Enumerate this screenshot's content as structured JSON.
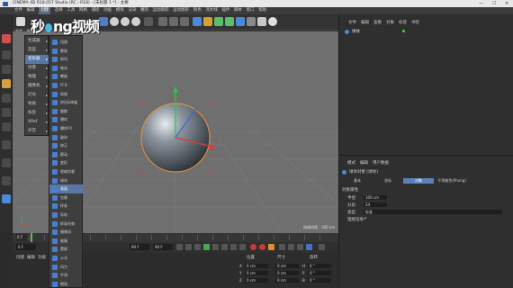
{
  "window": {
    "title": "CINEMA 4D R18.057 Studio (RC - R18) - [未标题 1 *] - 主要",
    "controls": [
      "—",
      "☐",
      "✕"
    ]
  },
  "watermark": {
    "text_before": "秒",
    "text_after": "ng视频",
    "mascot_letter": "o"
  },
  "menubar": {
    "items": [
      "文件",
      "编辑",
      "创建",
      "选择",
      "工具",
      "网格",
      "捕捉",
      "动画",
      "模拟",
      "渲染",
      "雕刻",
      "运动跟踪",
      "运动图形",
      "角色",
      "流水线",
      "插件",
      "脚本",
      "窗口",
      "帮助"
    ],
    "active_index": 2
  },
  "viewport": {
    "tabs": [
      "查看",
      "摄像机",
      "显示",
      "选项",
      "过滤",
      "面板"
    ],
    "grid_distance": "网格间距 : 100 cm"
  },
  "create_menu": {
    "items": [
      {
        "label": "生成器",
        "has_sub": true
      },
      {
        "label": "造型",
        "has_sub": true
      },
      {
        "label": "变形器",
        "has_sub": true,
        "active": true
      },
      {
        "label": "场景",
        "has_sub": true
      },
      {
        "label": "物理",
        "has_sub": true
      },
      {
        "label": "摄像机",
        "has_sub": true
      },
      {
        "label": "灯光",
        "has_sub": true
      },
      {
        "label": "材质",
        "has_sub": true
      },
      {
        "label": "标签",
        "has_sub": true
      },
      {
        "label": "XRef",
        "has_sub": true
      },
      {
        "label": "声音",
        "has_sub": true
      }
    ]
  },
  "deformer_menu": {
    "items": [
      {
        "label": "扭曲",
        "color": "#4a7fd0"
      },
      {
        "label": "膨胀",
        "color": "#4a7fd0"
      },
      {
        "label": "斜切",
        "color": "#4a7fd0"
      },
      {
        "label": "锥化",
        "color": "#4a7fd0"
      },
      {
        "label": "螺旋",
        "color": "#4a7fd0"
      },
      {
        "label": "FFD",
        "color": "#4a7fd0"
      },
      {
        "label": "网格",
        "color": "#4a7fd0"
      },
      {
        "label": "挤压&伸展",
        "color": "#4a7fd0"
      },
      {
        "label": "融解",
        "color": "#4a7fd0"
      },
      {
        "label": "爆炸",
        "color": "#4a7fd0"
      },
      {
        "label": "爆炸FX",
        "color": "#4a7fd0"
      },
      {
        "label": "破碎",
        "color": "#4a7fd0"
      },
      {
        "label": "修正",
        "color": "#4a7fd0"
      },
      {
        "label": "颤动",
        "color": "#4a7fd0"
      },
      {
        "label": "变形",
        "color": "#4a7fd0"
      },
      {
        "label": "收缩包裹",
        "color": "#4a7fd0"
      },
      {
        "label": "球化",
        "color": "#4a7fd0"
      },
      {
        "label": "表面",
        "color": "#4a7fd0",
        "active": true
      },
      {
        "label": "包裹",
        "color": "#4a7fd0"
      },
      {
        "label": "样条",
        "color": "#4a7fd0"
      },
      {
        "label": "导轨",
        "color": "#4a7fd0"
      },
      {
        "label": "样条约束",
        "color": "#4a7fd0"
      },
      {
        "label": "摄像机",
        "color": "#4a7fd0"
      },
      {
        "label": "碰撞",
        "color": "#4a7fd0"
      },
      {
        "label": "置换",
        "color": "#4a7fd0"
      },
      {
        "label": "公式",
        "color": "#4a7fd0"
      },
      {
        "label": "风力",
        "color": "#4a7fd0"
      },
      {
        "label": "平滑",
        "color": "#4a7fd0"
      },
      {
        "label": "倒角",
        "color": "#4a7fd0"
      }
    ]
  },
  "timeline": {
    "frame": "0 F"
  },
  "transport": {
    "start": "0 F",
    "end": "90 F",
    "current": "90 F"
  },
  "bottom": {
    "tabs": [
      "创建",
      "编辑",
      "功能",
      "纹理"
    ],
    "coord_headers": [
      "位置",
      "尺寸",
      "旋转"
    ],
    "rows": [
      {
        "axis": "X",
        "pos": "0 cm",
        "size": "0 cm",
        "rot_label": "H",
        "rot": "0 °"
      },
      {
        "axis": "Y",
        "pos": "0 cm",
        "size": "0 cm",
        "rot_label": "P",
        "rot": "0 °"
      },
      {
        "axis": "Z",
        "pos": "0 cm",
        "size": "0 cm",
        "rot_label": "B",
        "rot": "0 °"
      }
    ]
  },
  "object_panel": {
    "tabs": [
      "文件",
      "编辑",
      "查看",
      "对象",
      "标签",
      "书签"
    ],
    "objects": [
      {
        "name": "球体"
      }
    ]
  },
  "attribute_panel": {
    "tabs": [
      "模式",
      "编辑",
      "用户数据"
    ],
    "object_title": "球体对象 [球体]",
    "sub_tabs": [
      "基本",
      "坐标",
      "对象",
      "平滑着色(Phong)"
    ],
    "active_sub_tab": 2,
    "section": "对象属性",
    "fields": [
      {
        "label": "半径",
        "value": "100 cm"
      },
      {
        "label": "分段",
        "value": "24"
      },
      {
        "label": "类型",
        "value": "标准"
      },
      {
        "label": "理想渲染",
        "value": "✔"
      }
    ]
  },
  "colors": {
    "menu_highlight": "#5977a6",
    "attr_tab_active": "#5b80b8",
    "sphere_outline": "#e0903a"
  }
}
